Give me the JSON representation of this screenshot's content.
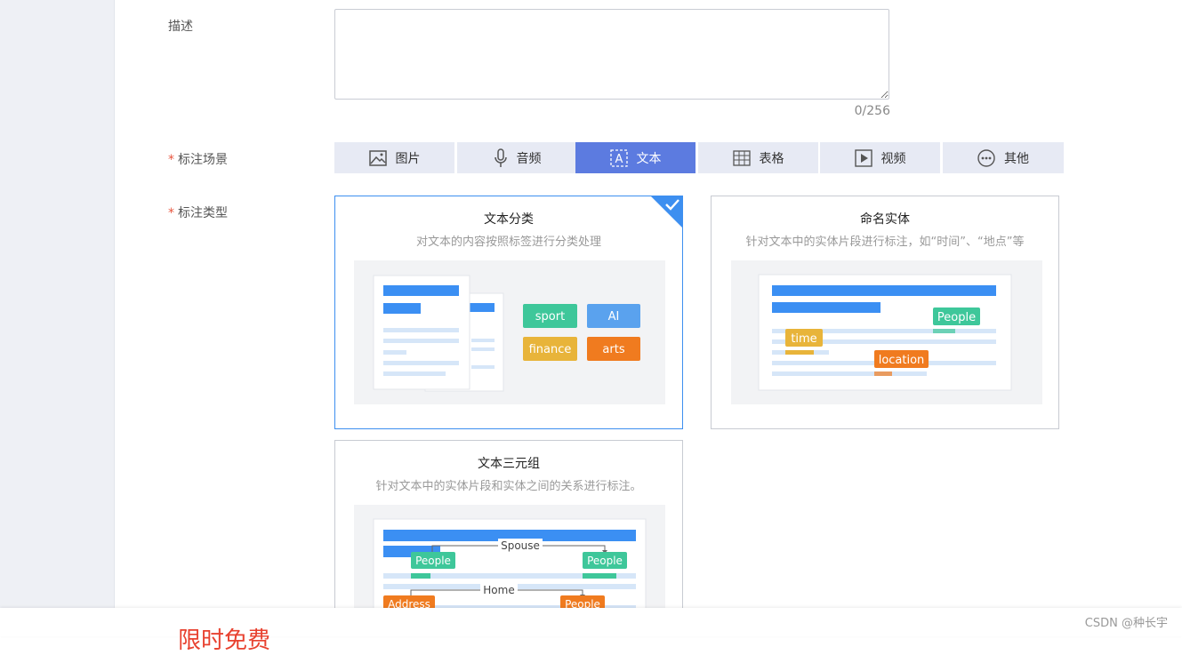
{
  "form": {
    "description_label": "描述",
    "description_value": "",
    "description_counter": "0/256",
    "scene_label": "标注场景",
    "type_label": "标注类型",
    "required_mark": "*"
  },
  "scenes": [
    {
      "label": "图片",
      "icon": "image-icon",
      "active": false
    },
    {
      "label": "音频",
      "icon": "microphone-icon",
      "active": false
    },
    {
      "label": "文本",
      "icon": "text-icon",
      "active": true
    },
    {
      "label": "表格",
      "icon": "table-icon",
      "active": false
    },
    {
      "label": "视频",
      "icon": "video-play-icon",
      "active": false
    },
    {
      "label": "其他",
      "icon": "more-icon",
      "active": false
    }
  ],
  "types": [
    {
      "title": "文本分类",
      "desc": "对文本的内容按照标签进行分类处理",
      "selected": true,
      "tags": [
        "sport",
        "AI",
        "finance",
        "arts"
      ]
    },
    {
      "title": "命名实体",
      "desc": "针对文本中的实体片段进行标注，如“时间”、“地点”等",
      "selected": false,
      "tags": [
        "People",
        "time",
        "location"
      ]
    },
    {
      "title": "文本三元组",
      "desc": "针对文本中的实体片段和实体之间的关系进行标注。",
      "selected": false,
      "tags": [
        "Spouse",
        "People",
        "People",
        "Home",
        "Address",
        "People"
      ]
    }
  ],
  "colors": {
    "accent": "#5c7be0",
    "selected_border": "#3d8ff0",
    "required": "#e8553e",
    "green": "#3ec79a",
    "orange": "#f07b1f",
    "yellow": "#e8b43a",
    "blue": "#3b8ff3"
  },
  "footer": {
    "promo": "限时免费",
    "watermark": "CSDN @种长宇"
  }
}
